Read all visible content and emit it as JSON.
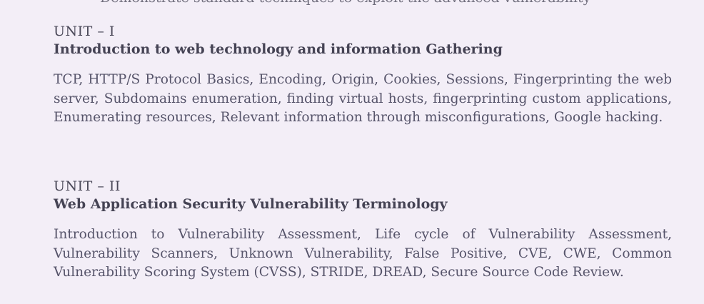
{
  "top_fragment": "Demonstrate standard techniques to exploit the advanced vulnerability",
  "units": [
    {
      "label": "UNIT – I",
      "title": "Introduction to web technology and information Gathering",
      "body": "TCP, HTTP/S Protocol Basics, Encoding, Origin, Cookies, Sessions, Fingerprinting the web server, Subdomains enumeration, finding virtual hosts, fingerprinting custom applications, Enumerating resources, Relevant information through misconfigurations, Google hacking."
    },
    {
      "label": "UNIT – II",
      "title": "Web Application Security Vulnerability Terminology",
      "body": "Introduction to Vulnerability Assessment, Life cycle of Vulnerability Assessment, Vulnerability Scanners, Unknown Vulnerability, False Positive, CVE, CWE, Common Vulnerability Scoring System (CVSS), STRIDE, DREAD, Secure Source Code Review."
    }
  ]
}
